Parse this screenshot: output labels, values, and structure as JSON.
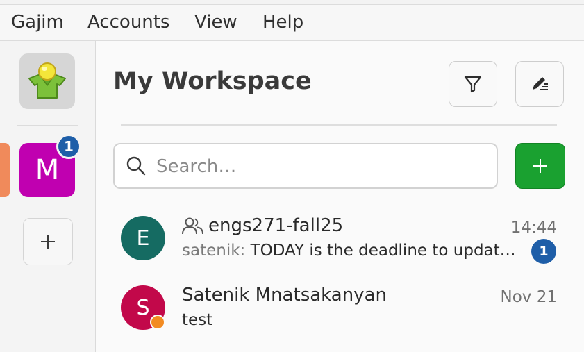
{
  "menubar": {
    "items": [
      "Gajim",
      "Accounts",
      "View",
      "Help"
    ]
  },
  "sidebar": {
    "app_icon": "gajim-avatar-icon",
    "account": {
      "initial": "M",
      "unread": "1",
      "color": "#c000b0"
    },
    "add_account_icon": "plus-icon"
  },
  "workspace": {
    "title": "My Workspace",
    "filter_icon": "filter-icon",
    "compose_icon": "edit-icon"
  },
  "search": {
    "placeholder": "Search…",
    "value": ""
  },
  "add_chat_icon": "plus-icon",
  "chats": [
    {
      "initial": "E",
      "avatar_color": "#156b62",
      "is_group": true,
      "group_icon": "group-icon",
      "name": "engs271-fall25",
      "time": "14:44",
      "sender": "satenik:",
      "preview": "TODAY is the deadline to updat…",
      "unread": "1"
    },
    {
      "initial": "S",
      "avatar_color": "#c2084a",
      "is_group": false,
      "name": "Satenik Mnatsakanyan",
      "time": "Nov 21",
      "preview": "test",
      "status": "away",
      "status_color": "#f28b22"
    }
  ]
}
